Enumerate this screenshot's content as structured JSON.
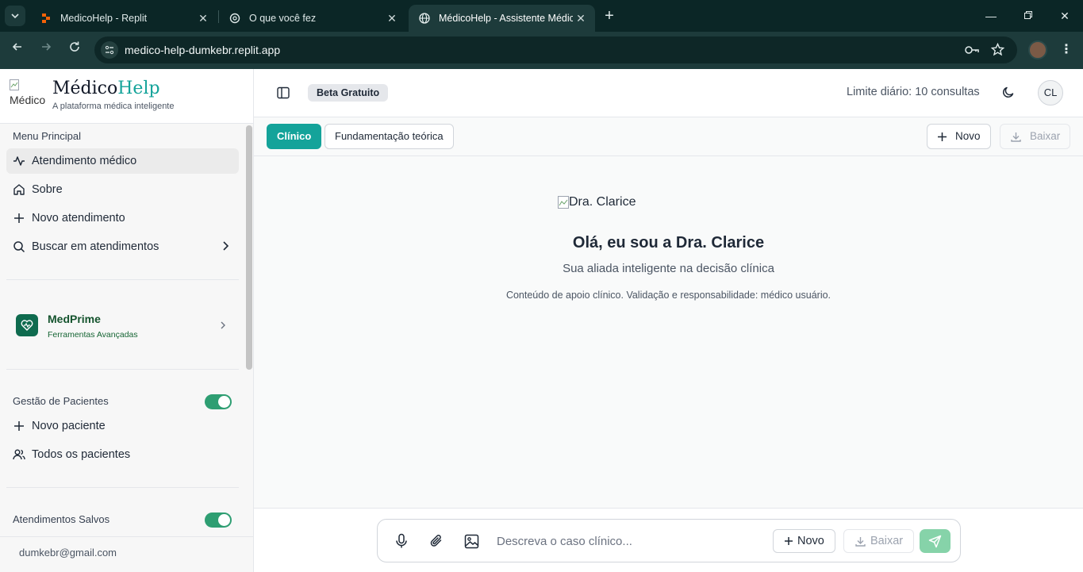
{
  "browser": {
    "tabs": [
      {
        "title": "MedicoHelp - Replit",
        "favicon": "replit-icon"
      },
      {
        "title": "O que você fez",
        "favicon": "chatgpt-icon"
      },
      {
        "title": "MédicoHelp - Assistente Médico",
        "favicon": "globe-icon",
        "active": true
      }
    ],
    "url": "medico-help-dumkebr.replit.app"
  },
  "sidebar": {
    "brand": {
      "img_alt": "Médico",
      "title_a": "Médico",
      "title_b": "Help",
      "subtitle": "A plataforma médica inteligente"
    },
    "menu_label": "Menu Principal",
    "menu_items": [
      {
        "label": "Atendimento médico",
        "icon": "activity-icon",
        "active": true
      },
      {
        "label": "Sobre",
        "icon": "home-icon"
      },
      {
        "label": "Novo atendimento",
        "icon": "plus-icon"
      },
      {
        "label": "Buscar em atendimentos",
        "icon": "search-icon"
      }
    ],
    "medprime": {
      "title": "MedPrime",
      "subtitle": "Ferramentas Avançadas"
    },
    "patients_label": "Gestão de Pacientes",
    "patients_toggle_on": true,
    "patient_items": [
      {
        "label": "Novo paciente",
        "icon": "plus-icon"
      },
      {
        "label": "Todos os pacientes",
        "icon": "users-icon"
      }
    ],
    "saved_label": "Atendimentos Salvos",
    "saved_toggle_on": true,
    "email": "dumkebr@gmail.com"
  },
  "header": {
    "beta": "Beta Gratuito",
    "limit": "Limite diário: 10 consultas",
    "avatar": "CL"
  },
  "modes": {
    "clinical": "Clínico",
    "theory": "Fundamentação teórica",
    "new": "Novo",
    "download": "Baixar"
  },
  "hero": {
    "img_alt": "Dra. Clarice",
    "title": "Olá, eu sou a Dra. Clarice",
    "subtitle": "Sua aliada inteligente na decisão clínica",
    "note": "Conteúdo de apoio clínico. Validação e responsabilidade: médico usuário."
  },
  "composer": {
    "placeholder": "Descreva o caso clínico...",
    "new": "Novo",
    "download": "Baixar"
  },
  "colors": {
    "brand_accent": "#14a39a",
    "toggle_on": "#2e9e72",
    "send_button": "#86d3a9",
    "browser_chrome": "#1d3b3b"
  }
}
